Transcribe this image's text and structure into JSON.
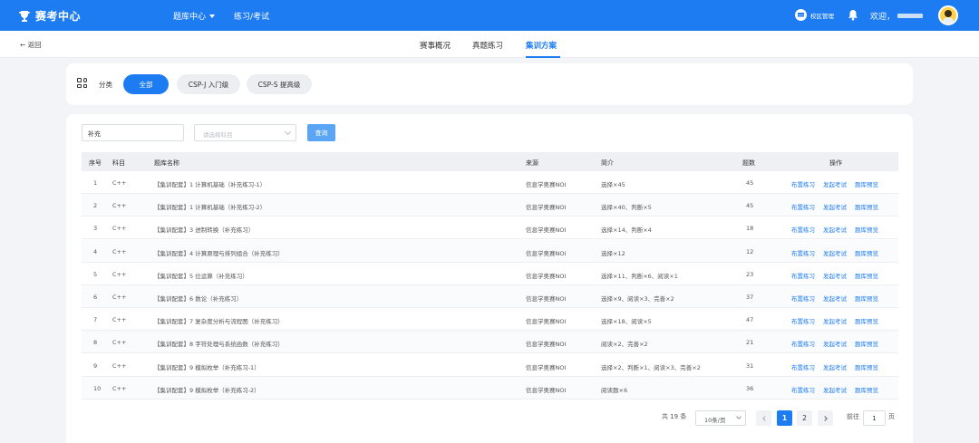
{
  "header": {
    "app_title": "赛考中心",
    "nav": [
      {
        "label": "题库中心"
      },
      {
        "label": "练习/考试"
      }
    ],
    "campus_label": "校区管理",
    "welcome": "欢迎，"
  },
  "subnav": {
    "back_label": "← 返回",
    "tabs": [
      {
        "label": "赛事概况"
      },
      {
        "label": "真题练习"
      },
      {
        "label": "集训方案",
        "active": true
      }
    ]
  },
  "categories": {
    "label": "分类",
    "pills": [
      {
        "label": "全部",
        "active": true
      },
      {
        "label": "CSP-J 入门级"
      },
      {
        "label": "CSP-S 提高级"
      }
    ]
  },
  "filters": {
    "search_value": "补充",
    "subject_placeholder": "请选择科目",
    "query_label": "查询"
  },
  "table": {
    "headers": [
      "序号",
      "科目",
      "题库名称",
      "来源",
      "简介",
      "题数",
      "操作"
    ],
    "actions": [
      "布置练习",
      "发起考试",
      "题库预览"
    ],
    "rows": [
      {
        "no": "1",
        "subject": "C++",
        "name": "【集训配套】1 计算机基础（补充练习-1）",
        "source": "信息学奥赛NOI",
        "intro": "选择×45",
        "count": "45"
      },
      {
        "no": "2",
        "subject": "C++",
        "name": "【集训配套】1 计算机基础（补充练习-2）",
        "source": "信息学奥赛NOI",
        "intro": "选择×40、判断×5",
        "count": "45"
      },
      {
        "no": "3",
        "subject": "C++",
        "name": "【集训配套】3 进制转换（补充练习）",
        "source": "信息学奥赛NOI",
        "intro": "选择×14、判断×4",
        "count": "18"
      },
      {
        "no": "4",
        "subject": "C++",
        "name": "【集训配套】4 计算原理与排列组合（补充练习）",
        "source": "信息学奥赛NOI",
        "intro": "选择×12",
        "count": "12"
      },
      {
        "no": "5",
        "subject": "C++",
        "name": "【集训配套】5 位运算（补充练习）",
        "source": "信息学奥赛NOI",
        "intro": "选择×11、判断×6、阅读×1",
        "count": "23"
      },
      {
        "no": "6",
        "subject": "C++",
        "name": "【集训配套】6 数论（补充练习）",
        "source": "信息学奥赛NOI",
        "intro": "选择×9、阅读×3、完善×2",
        "count": "37"
      },
      {
        "no": "7",
        "subject": "C++",
        "name": "【集训配套】7 复杂度分析与流程图（补充练习）",
        "source": "信息学奥赛NOI",
        "intro": "选择×18、阅读×5",
        "count": "47"
      },
      {
        "no": "8",
        "subject": "C++",
        "name": "【集训配套】8 字符处理与系统函数（补充练习）",
        "source": "信息学奥赛NOI",
        "intro": "阅读×2、完善×2",
        "count": "21"
      },
      {
        "no": "9",
        "subject": "C++",
        "name": "【集训配套】9 模拟枚举（补充练习-1）",
        "source": "信息学奥赛NOI",
        "intro": "选择×2、判断×1、阅读×3、完善×2",
        "count": "31"
      },
      {
        "no": "10",
        "subject": "C++",
        "name": "【集训配套】9 模拟枚举（补充练习-2）",
        "source": "信息学奥赛NOI",
        "intro": "阅读题×6",
        "count": "36"
      }
    ]
  },
  "pagination": {
    "total": "共 19 条",
    "page_size": "10条/页",
    "pages": [
      "1",
      "2"
    ],
    "current": "1",
    "goto_prefix": "前往",
    "goto_value": "1",
    "goto_suffix": "页"
  },
  "colors": {
    "primary": "#1e7cf2",
    "background": "#f2f4f8"
  }
}
